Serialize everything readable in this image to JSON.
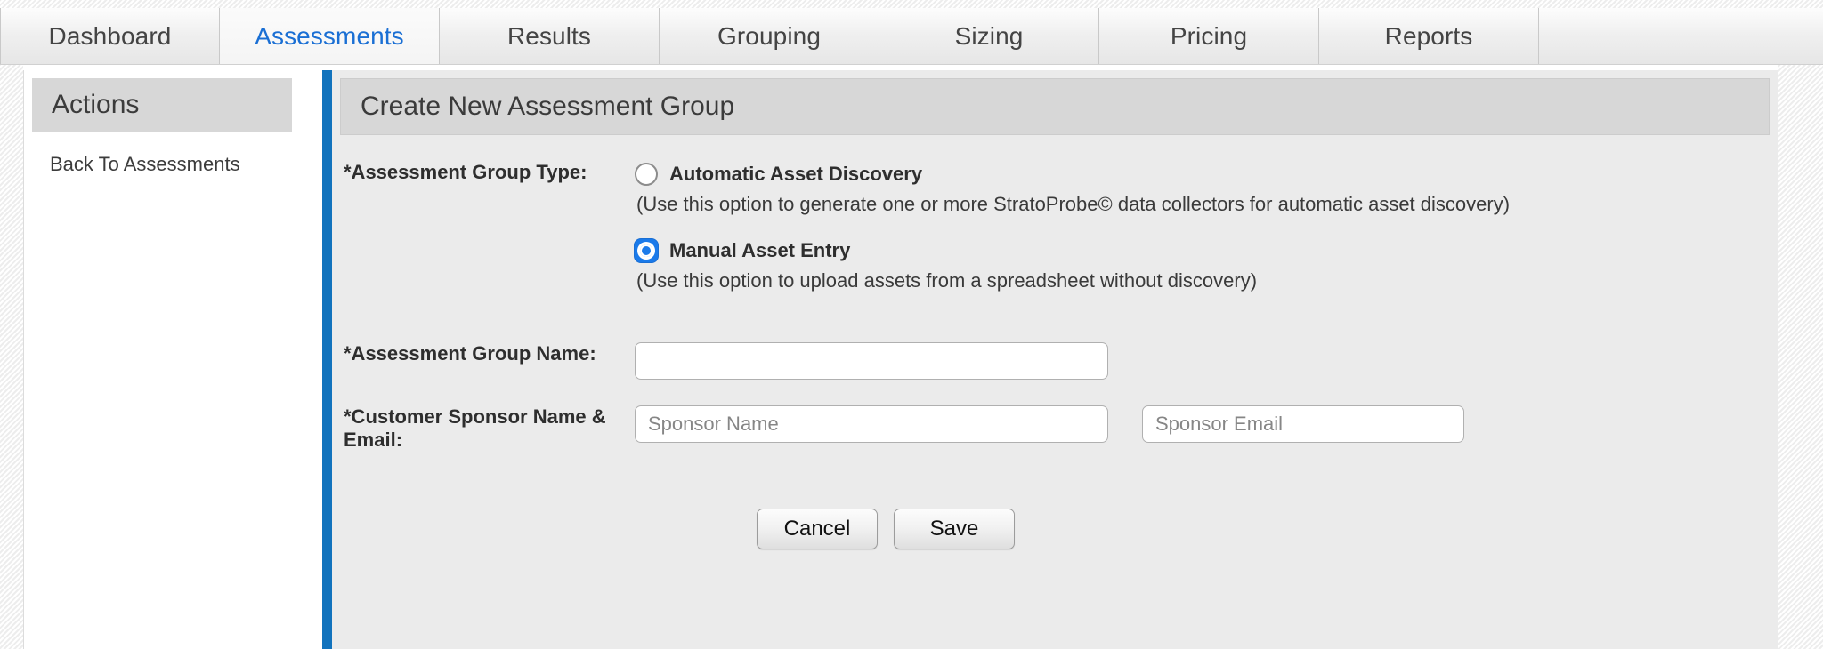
{
  "tabs": [
    {
      "label": "Dashboard",
      "active": false
    },
    {
      "label": "Assessments",
      "active": true
    },
    {
      "label": "Results",
      "active": false
    },
    {
      "label": "Grouping",
      "active": false
    },
    {
      "label": "Sizing",
      "active": false
    },
    {
      "label": "Pricing",
      "active": false
    },
    {
      "label": "Reports",
      "active": false
    }
  ],
  "sidebar": {
    "title": "Actions",
    "items": [
      {
        "label": "Back To Assessments"
      }
    ]
  },
  "main": {
    "panel_title": "Create New Assessment Group",
    "form": {
      "group_type_label": "*Assessment Group Type:",
      "options": [
        {
          "label": "Automatic Asset Discovery",
          "hint": "(Use this option to generate one or more StratoProbe© data collectors for automatic asset discovery)",
          "selected": false
        },
        {
          "label": "Manual Asset Entry",
          "hint": "(Use this option to upload assets from a spreadsheet without discovery)",
          "selected": true
        }
      ],
      "group_name_label": "*Assessment Group Name:",
      "group_name_value": "",
      "group_name_placeholder": "",
      "sponsor_label": "*Customer Sponsor Name & Email:",
      "sponsor_name_value": "",
      "sponsor_name_placeholder": "Sponsor Name",
      "sponsor_email_value": "",
      "sponsor_email_placeholder": "Sponsor Email"
    },
    "buttons": {
      "cancel_label": "Cancel",
      "save_label": "Save"
    }
  },
  "colors": {
    "accent_blue": "#1273bd",
    "active_tab_text": "#1a6fd4",
    "radio_selected": "#1a7aea",
    "panel_background": "#ebebeb",
    "header_background": "#d7d7d7"
  }
}
